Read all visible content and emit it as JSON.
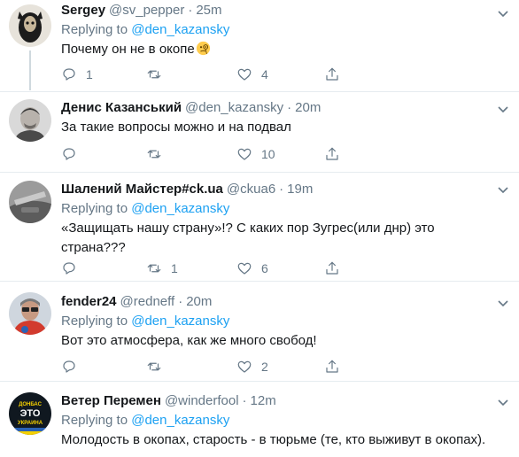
{
  "tweets": [
    {
      "name": "Sergey",
      "handle": "@sv_pepper",
      "dot": "·",
      "time": "25m",
      "replying_prefix": "Replying to ",
      "replying_to": "@den_kazansky",
      "text": "Почему он не в окопе",
      "emoji": "face-with-monocle",
      "replies": "1",
      "retweets": "",
      "likes": "4"
    },
    {
      "name": "Денис Казанський",
      "handle": "@den_kazansky",
      "dot": "·",
      "time": "20m",
      "replying_prefix": "",
      "replying_to": "",
      "text": "За такие вопросы можно и на подвал",
      "replies": "",
      "retweets": "",
      "likes": "10"
    },
    {
      "name": "Шалений Майстер#ck.ua",
      "handle": "@ckua6",
      "dot": "·",
      "time": "19m",
      "replying_prefix": "Replying to ",
      "replying_to": "@den_kazansky",
      "text": "«Защищать нашу страну»!? С каких пор Зугрес(или днр) это страна???",
      "replies": "",
      "retweets": "1",
      "likes": "6"
    },
    {
      "name": "fender24",
      "handle": "@redneff",
      "dot": "·",
      "time": "20m",
      "replying_prefix": "Replying to ",
      "replying_to": "@den_kazansky",
      "text": "Вот это атмосфера, как же много свобод!",
      "replies": "",
      "retweets": "",
      "likes": "2"
    },
    {
      "name": "Ветер Перемен",
      "handle": "@winderfool",
      "dot": "·",
      "time": "12m",
      "replying_prefix": "Replying to ",
      "replying_to": "@den_kazansky",
      "text": "Молодость в окопах, старость - в тюрьме (те, кто выживут в окопах).",
      "avatar_text": [
        "ДОНБАС",
        "ЭТО",
        "УКРАИНА"
      ]
    }
  ],
  "colors": {
    "accent": "#1da1f2",
    "muted": "#657786",
    "text": "#14171a",
    "divider": "#e6ecf0"
  }
}
